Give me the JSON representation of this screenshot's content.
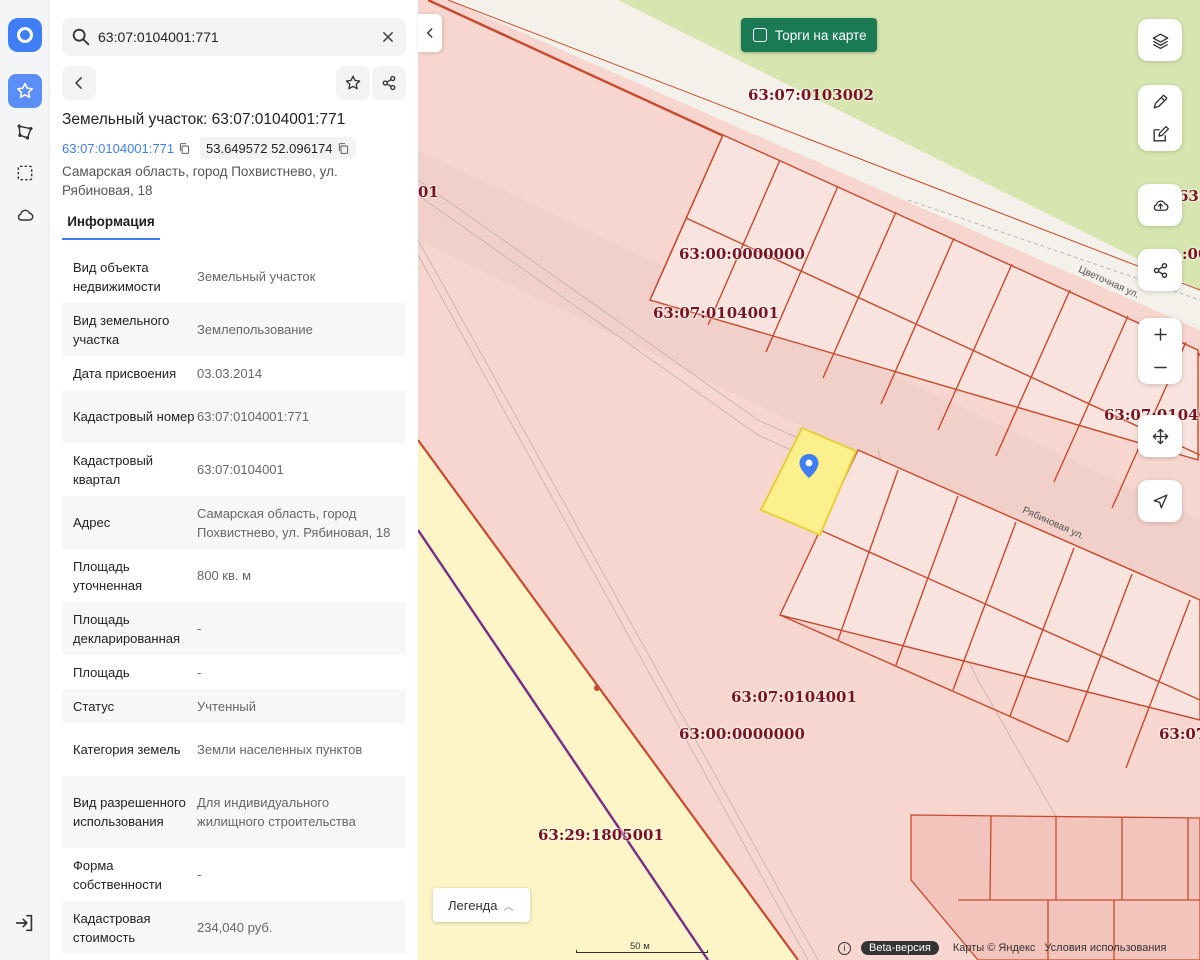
{
  "search": {
    "value": "63:07:0104001:771"
  },
  "parcel": {
    "title": "Земельный участок: 63:07:0104001:771",
    "cadastral_link": "63:07:0104001:771",
    "coordinates": "53.649572 52.096174",
    "address": "Самарская область, город Похвистнево, ул. Рябиновая, 18"
  },
  "tabs": [
    {
      "label": "Информация"
    }
  ],
  "info_rows": [
    {
      "key": "Вид объекта недвижимости",
      "value": "Земельный участок"
    },
    {
      "key": "Вид земельного участка",
      "value": "Землепользование"
    },
    {
      "key": "Дата присвоения",
      "value": "03.03.2014"
    },
    {
      "key": "Кадастровый номер",
      "value": "63:07:0104001:771"
    },
    {
      "key": "Кадастровый квартал",
      "value": "63:07:0104001"
    },
    {
      "key": "Адрес",
      "value": "Самарская область, город Похвистнево, ул. Рябиновая, 18"
    },
    {
      "key": "Площадь уточненная",
      "value": "800 кв. м"
    },
    {
      "key": "Площадь декларированная",
      "value": "-"
    },
    {
      "key": "Площадь",
      "value": "-"
    },
    {
      "key": "Статус",
      "value": "Учтенный"
    },
    {
      "key": "Категория земель",
      "value": "Земли населенных пунктов"
    },
    {
      "key": "Вид разрешенного использования",
      "value": "Для индивидуального жилищного строительства"
    },
    {
      "key": "Форма собственности",
      "value": "-"
    },
    {
      "key": "Кадастровая стоимость",
      "value": "234,040 руб."
    }
  ],
  "map": {
    "torgi_label": "Торги на карте",
    "labels": {
      "l1": "63:07:0103002",
      "l2": "63:00:0000000",
      "l3": "63:07:0104001",
      "l4": "63:07:0104001",
      "l5": "63:00:0000000",
      "l6": "63:29:1805001",
      "edge_left": "01",
      "edge_r1": "63:",
      "edge_r2": ":00",
      "edge_r3": "63:07:01040",
      "edge_r4": "63:07"
    },
    "streets": {
      "s1": "Цветочная ул.",
      "s2": "Рябиновая ул."
    },
    "legend_label": "Легенда",
    "scale_label": "50 м",
    "beta_label": "Beta-версия",
    "attribution": "Карты © Яндекс",
    "terms": "Условия использования"
  },
  "colors": {
    "accent": "#3f7ef5",
    "torgi_bg": "#1a7a55",
    "cadastral_fill": "#f6d6cf",
    "parcel_line": "#c8492e",
    "selected_parcel": "#fbf08c",
    "green_zone": "#d7e6b0",
    "yellow_zone": "#fdf5c8",
    "label_text": "#7a1220"
  }
}
